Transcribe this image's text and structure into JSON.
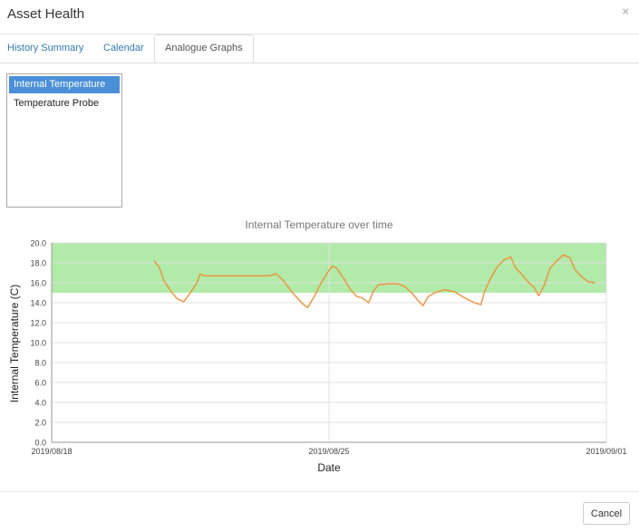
{
  "dialog": {
    "title": "Asset Health",
    "close_glyph": "×"
  },
  "tabs": [
    {
      "label": "History Summary"
    },
    {
      "label": "Calendar"
    },
    {
      "label": "Analogue Graphs"
    }
  ],
  "active_tab": "Analogue Graphs",
  "sensor_list": {
    "items": [
      "Internal Temperature",
      "Temperature Probe"
    ],
    "selected": "Internal Temperature"
  },
  "colors": {
    "accent": "#4a90d9",
    "line": "#f0913a",
    "band": "#a8e8a0"
  },
  "chart_data": {
    "type": "line",
    "title": "Internal Temperature over time",
    "xlabel": "Date",
    "ylabel": "Internal Temperature (C)",
    "x_ticks": [
      "2019/08/18",
      "2019/08/25",
      "2019/09/01"
    ],
    "xlim": [
      "2019/08/18",
      "2019/09/01"
    ],
    "ylim": [
      0,
      20
    ],
    "y_ticks": [
      "0.0",
      "2.0",
      "4.0",
      "6.0",
      "8.0",
      "10.0",
      "12.0",
      "14.0",
      "16.0",
      "18.0",
      "20.0"
    ],
    "grid": true,
    "bands": [
      {
        "from": 15,
        "to": 20
      }
    ],
    "series": [
      {
        "points": [
          [
            "2019/08/20 14:00",
            18.2
          ],
          [
            "2019/08/20 17:00",
            17.6
          ],
          [
            "2019/08/20 20:00",
            16.2
          ],
          [
            "2019/08/21 00:00",
            15.2
          ],
          [
            "2019/08/21 04:00",
            14.4
          ],
          [
            "2019/08/21 08:00",
            14.1
          ],
          [
            "2019/08/21 12:00",
            15.0
          ],
          [
            "2019/08/21 16:00",
            16.0
          ],
          [
            "2019/08/21 18:00",
            16.9
          ],
          [
            "2019/08/21 20:00",
            16.7
          ],
          [
            "2019/08/22 12:00",
            16.7
          ],
          [
            "2019/08/23 12:00",
            16.7
          ],
          [
            "2019/08/23 16:00",
            16.9
          ],
          [
            "2019/08/23 20:00",
            16.3
          ],
          [
            "2019/08/24 00:00",
            15.4
          ],
          [
            "2019/08/24 04:00",
            14.6
          ],
          [
            "2019/08/24 08:00",
            13.9
          ],
          [
            "2019/08/24 11:00",
            13.5
          ],
          [
            "2019/08/24 15:00",
            14.6
          ],
          [
            "2019/08/24 19:00",
            15.9
          ],
          [
            "2019/08/24 23:00",
            17.0
          ],
          [
            "2019/08/25 02:00",
            17.7
          ],
          [
            "2019/08/25 05:00",
            17.4
          ],
          [
            "2019/08/25 09:00",
            16.4
          ],
          [
            "2019/08/25 13:00",
            15.3
          ],
          [
            "2019/08/25 17:00",
            14.6
          ],
          [
            "2019/08/25 20:00",
            14.5
          ],
          [
            "2019/08/26 00:00",
            14.0
          ],
          [
            "2019/08/26 03:00",
            15.2
          ],
          [
            "2019/08/26 06:00",
            15.8
          ],
          [
            "2019/08/26 12:00",
            15.9
          ],
          [
            "2019/08/26 18:00",
            15.9
          ],
          [
            "2019/08/26 22:00",
            15.6
          ],
          [
            "2019/08/27 02:00",
            15.0
          ],
          [
            "2019/08/27 06:00",
            14.2
          ],
          [
            "2019/08/27 09:00",
            13.7
          ],
          [
            "2019/08/27 12:00",
            14.6
          ],
          [
            "2019/08/27 16:00",
            15.0
          ],
          [
            "2019/08/27 22:00",
            15.3
          ],
          [
            "2019/08/28 04:00",
            15.1
          ],
          [
            "2019/08/28 10:00",
            14.5
          ],
          [
            "2019/08/28 16:00",
            14.0
          ],
          [
            "2019/08/28 20:00",
            13.8
          ],
          [
            "2019/08/28 22:00",
            15.0
          ],
          [
            "2019/08/29 02:00",
            16.5
          ],
          [
            "2019/08/29 06:00",
            17.6
          ],
          [
            "2019/08/29 10:00",
            18.3
          ],
          [
            "2019/08/29 14:00",
            18.6
          ],
          [
            "2019/08/29 17:00",
            17.5
          ],
          [
            "2019/08/29 21:00",
            16.8
          ],
          [
            "2019/08/30 01:00",
            16.0
          ],
          [
            "2019/08/30 04:00",
            15.6
          ],
          [
            "2019/08/30 07:00",
            14.7
          ],
          [
            "2019/08/30 10:00",
            15.6
          ],
          [
            "2019/08/30 14:00",
            17.5
          ],
          [
            "2019/08/30 18:00",
            18.2
          ],
          [
            "2019/08/30 22:00",
            18.8
          ],
          [
            "2019/08/31 02:00",
            18.5
          ],
          [
            "2019/08/31 05:00",
            17.3
          ],
          [
            "2019/08/31 09:00",
            16.6
          ],
          [
            "2019/08/31 13:00",
            16.1
          ],
          [
            "2019/08/31 17:00",
            16.0
          ]
        ]
      }
    ]
  },
  "footer": {
    "cancel_label": "Cancel"
  }
}
